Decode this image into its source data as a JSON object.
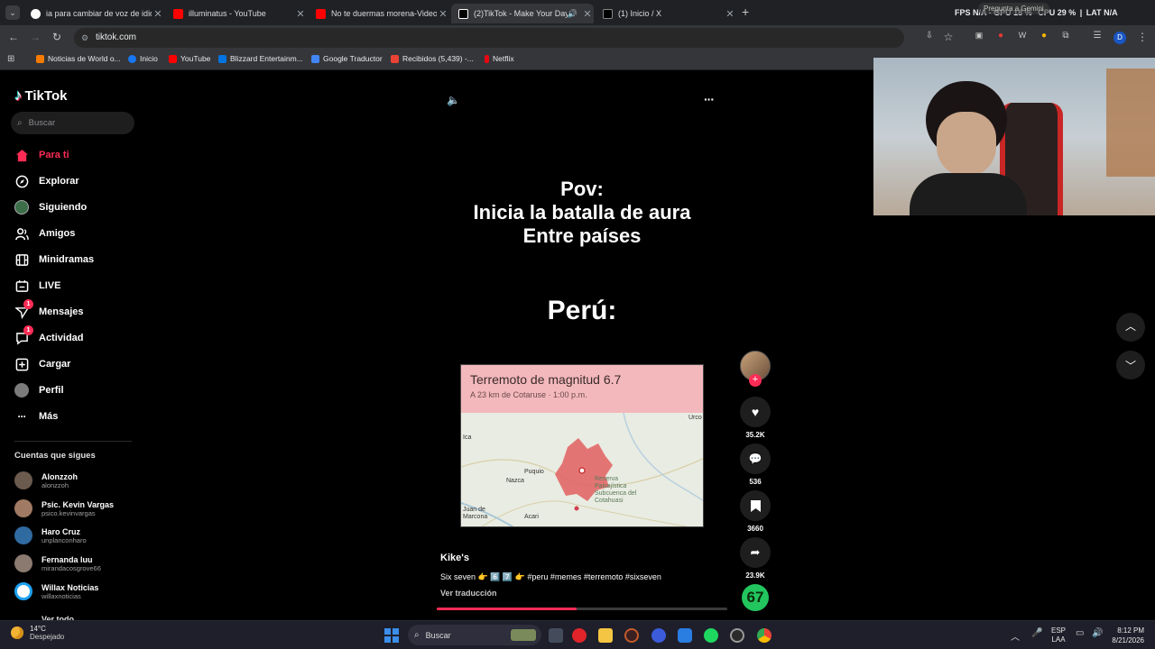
{
  "tabs": [
    {
      "title": "ia para cambiar de voz de idiom",
      "color": "#4285f4"
    },
    {
      "title": "illuminatus - YouTube",
      "color": "#ff0000"
    },
    {
      "title": "No te duermas morena-Videos",
      "color": "#ff0000"
    },
    {
      "title": "(2)TikTok - Make Your Day",
      "color": "#ffffff"
    },
    {
      "title": "(1) Inicio / X",
      "color": "#ffffff"
    }
  ],
  "new_tab": "+",
  "overlay": {
    "left": "FPS N/A - GPU 18 %",
    "cpu": "CPU 29 %",
    "lat": "LAT N/A",
    "gemini": "Pregunta a Gemini"
  },
  "url": "tiktok.com",
  "bookmarks": [
    {
      "label": "Noticias de World o...",
      "color": "#f57c00"
    },
    {
      "label": "Inicio",
      "color": "#1877f2"
    },
    {
      "label": "YouTube",
      "color": "#ff0000"
    },
    {
      "label": "Blizzard Entertainm...",
      "color": "#0074e0"
    },
    {
      "label": "Google Traductor",
      "color": "#4285f4"
    },
    {
      "label": "Recibidos (5,439) -...",
      "color": "#ea4335"
    },
    {
      "label": "Netflix",
      "color": "#e50914"
    }
  ],
  "logo": "TikTok",
  "search_placeholder": "Buscar",
  "nav": [
    {
      "label": "Para ti",
      "icon": "home-icon"
    },
    {
      "label": "Explorar",
      "icon": "compass-icon"
    },
    {
      "label": "Siguiendo",
      "icon": "following-icon"
    },
    {
      "label": "Amigos",
      "icon": "friends-icon"
    },
    {
      "label": "Minidramas",
      "icon": "film-icon"
    },
    {
      "label": "LIVE",
      "icon": "live-icon"
    },
    {
      "label": "Mensajes",
      "icon": "messages-icon",
      "badge": "1"
    },
    {
      "label": "Actividad",
      "icon": "activity-icon",
      "badge": "1"
    },
    {
      "label": "Cargar",
      "icon": "upload-icon"
    },
    {
      "label": "Perfil",
      "icon": "profile-icon"
    },
    {
      "label": "Más",
      "icon": "more-icon"
    }
  ],
  "following_title": "Cuentas que sigues",
  "following": [
    {
      "name": "Alonzzoh",
      "handle": "alonzzoh",
      "color": "#6b5a4e"
    },
    {
      "name": "Psic. Kevin Vargas",
      "handle": "psico.kevinvargas",
      "color": "#a07a62"
    },
    {
      "name": "Haro Cruz",
      "handle": "unplanconharo",
      "color": "#2f6aa0"
    },
    {
      "name": "Fernanda luu",
      "handle": "mirandacosgrove66",
      "color": "#8a7a70"
    },
    {
      "name": "Willax Noticias",
      "handle": "willaxnoticias",
      "color": "#1da1f2"
    }
  ],
  "see_all": "Ver todo",
  "video": {
    "pov_line1": "Pov:",
    "pov_line2": "Inicia la batalla de aura",
    "pov_line3": "Entre países",
    "country": "Perú:",
    "card_title": "Terremoto de magnitud 6.7",
    "card_sub": "A 23 km de Cotaruse · 1:00 p.m.",
    "map_labels": {
      "ica": "Ica",
      "nazca": "Nazca",
      "puquio": "Puquio",
      "reserve": "Reserva Paisajística Subcuenca del Cotahuasi",
      "juan": "Juan de Marcona",
      "acari": "Acari",
      "urco": "Urco"
    },
    "author": "Kike's",
    "caption": "Six seven 👉 6️⃣ 7️⃣ 👉 #peru #memes #terremoto #sixseven",
    "translate": "Ver traducción",
    "progress": 0.48
  },
  "actions": {
    "likes": "35.2K",
    "comments": "536",
    "saves": "3660",
    "shares": "23.9K",
    "badge": "67"
  },
  "taskbar": {
    "weather_temp": "14°C",
    "weather_desc": "Despejado",
    "search": "Buscar",
    "lang1": "ESP",
    "lang2": "LAA",
    "time": "8:12 PM",
    "date": "8/21/2026"
  }
}
